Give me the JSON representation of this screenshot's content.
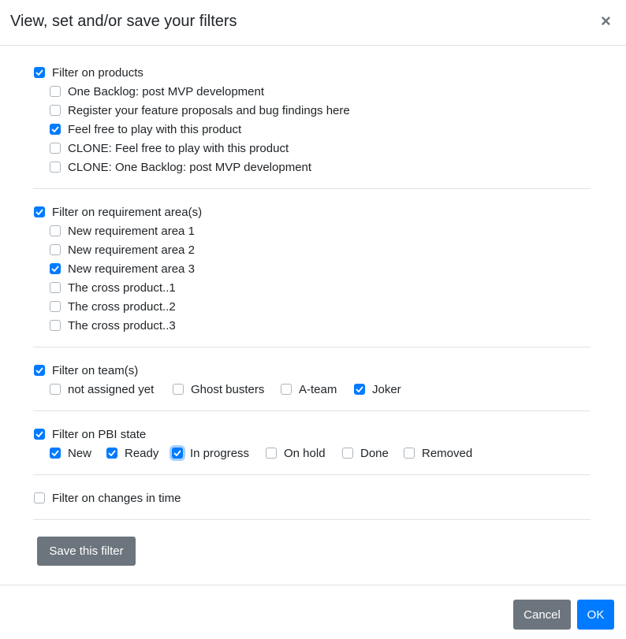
{
  "modal": {
    "title": "View, set and/or save your filters",
    "close_symbol": "×",
    "save_label": "Save this filter",
    "cancel_label": "Cancel",
    "ok_label": "OK"
  },
  "products": {
    "header": "Filter on products",
    "checked": true,
    "items": [
      {
        "label": "One Backlog: post MVP development",
        "checked": false
      },
      {
        "label": "Register your feature proposals and bug findings here",
        "checked": false
      },
      {
        "label": "Feel free to play with this product",
        "checked": true
      },
      {
        "label": "CLONE: Feel free to play with this product",
        "checked": false
      },
      {
        "label": "CLONE: One Backlog: post MVP development",
        "checked": false
      }
    ]
  },
  "areas": {
    "header": "Filter on requirement area(s)",
    "checked": true,
    "items": [
      {
        "label": "New requirement area 1",
        "checked": false
      },
      {
        "label": "New requirement area 2",
        "checked": false
      },
      {
        "label": "New requirement area 3",
        "checked": true
      },
      {
        "label": "The cross product..1",
        "checked": false
      },
      {
        "label": "The cross product..2",
        "checked": false
      },
      {
        "label": "The cross product..3",
        "checked": false
      }
    ]
  },
  "teams": {
    "header": "Filter on team(s)",
    "checked": true,
    "items": [
      {
        "label": "not assigned yet",
        "checked": false
      },
      {
        "label": "Ghost busters",
        "checked": false
      },
      {
        "label": "A-team",
        "checked": false
      },
      {
        "label": "Joker",
        "checked": true
      }
    ]
  },
  "states": {
    "header": "Filter on PBI state",
    "checked": true,
    "items": [
      {
        "label": "New",
        "checked": true
      },
      {
        "label": "Ready",
        "checked": true
      },
      {
        "label": "In progress",
        "checked": true
      },
      {
        "label": "On hold",
        "checked": false
      },
      {
        "label": "Done",
        "checked": false
      },
      {
        "label": "Removed",
        "checked": false
      }
    ]
  },
  "time": {
    "header": "Filter on changes in time",
    "checked": false
  },
  "colors": {
    "accent": "#007bff",
    "secondary": "#6c757d",
    "border": "#dee2e6"
  }
}
